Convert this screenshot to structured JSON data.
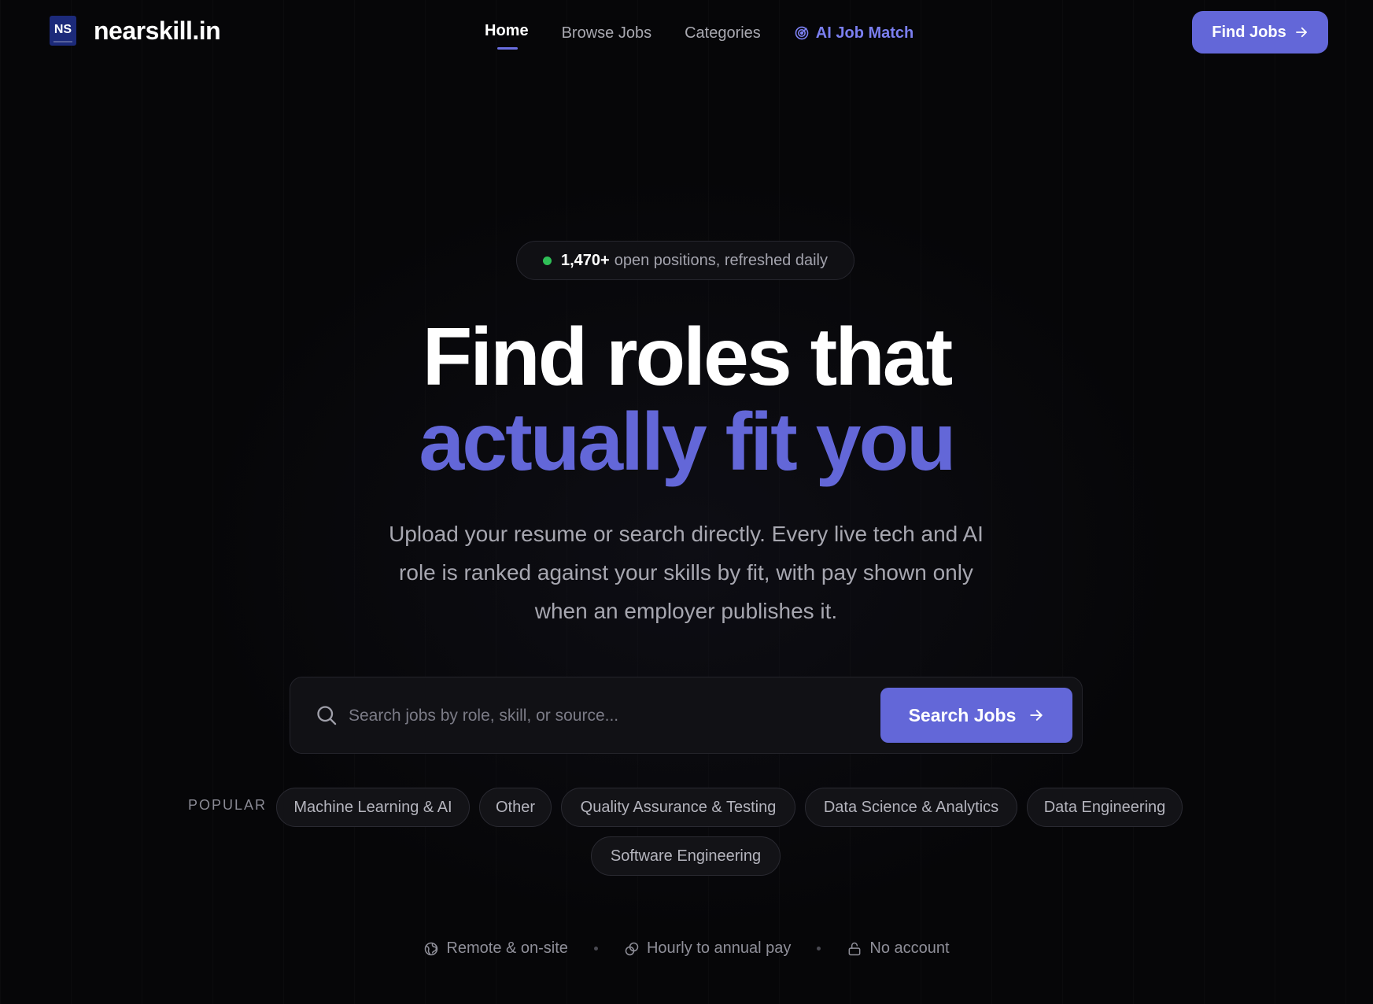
{
  "brand": {
    "logo_text": "NS",
    "name": "nearskill.in"
  },
  "nav": {
    "links": [
      {
        "label": "Home"
      },
      {
        "label": "Browse Jobs"
      },
      {
        "label": "Categories"
      },
      {
        "label": "AI Job Match"
      }
    ],
    "cta_label": "Find Jobs"
  },
  "hero": {
    "badge_count": "1,470+",
    "badge_text": "open positions, refreshed daily",
    "headline_line1": "Find roles that",
    "headline_line2": "actually fit you",
    "subtitle": "Upload your resume or search directly. Every live tech and AI role is ranked against your skills by fit, with pay shown only when an employer publishes it."
  },
  "search": {
    "value": "",
    "placeholder": "Search jobs by role, skill, or source...",
    "button_label": "Search Jobs"
  },
  "popular": {
    "label": "POPULAR",
    "chips": [
      "Machine Learning & AI",
      "Other",
      "Quality Assurance & Testing",
      "Data Science & Analytics",
      "Data Engineering",
      "Software Engineering"
    ]
  },
  "features": [
    {
      "icon": "globe-icon",
      "label": "Remote & on-site"
    },
    {
      "icon": "coins-icon",
      "label": "Hourly to annual pay"
    },
    {
      "icon": "lock-open-icon",
      "label": "No account"
    }
  ],
  "colors": {
    "accent": "#6367d8",
    "background": "#060608",
    "status_dot": "#2fbf57"
  }
}
